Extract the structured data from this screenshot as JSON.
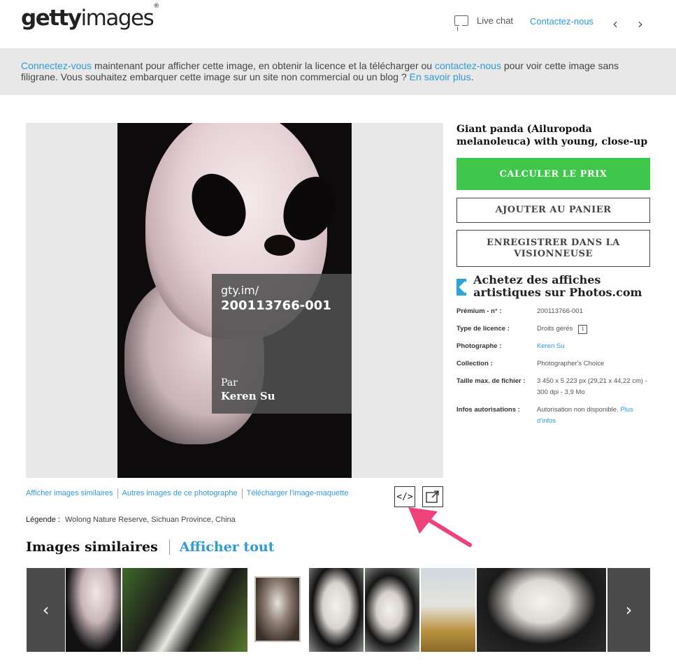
{
  "header": {
    "logo_bold": "getty",
    "logo_light": "images",
    "logo_mark": "®",
    "live_chat": "Live chat",
    "contact": "Contactez-nous",
    "prev_icon": "chevron-left-icon",
    "next_icon": "chevron-right-icon"
  },
  "banner": {
    "link1": "Connectez-vous",
    "text1": " maintenant pour afficher cette image, en obtenir la licence et la télécharger ou ",
    "link2": "contactez-nous",
    "text2": " pour voir cette image sans filigrane. Vous souhaitez embarquer cette image sur un site non commercial ou un blog ? ",
    "link3": "En savoir plus",
    "text3": "."
  },
  "watermark": {
    "url": "gty.im/",
    "id": "200113766-001",
    "by": "Par",
    "name": "Keren Su"
  },
  "image_links": [
    "Afficher images similaires",
    "Autres images de ce photographe",
    "Télécharger l'image-maquette"
  ],
  "tools": {
    "embed": "</>",
    "expand": "↗"
  },
  "legend": {
    "label": "Légende :",
    "value": "Wolong Nature Reserve, Sichuan Province, China"
  },
  "similar": {
    "title": "Images similaires",
    "all": "Afficher tout"
  },
  "strip_nav": {
    "prev": "‹",
    "next": "›"
  },
  "side": {
    "title": "Giant panda (Ailuropoda melanoleuca) with young, close-up",
    "calc_button": "CALCULER LE PRIX",
    "cart_button": "AJOUTER AU PANIER",
    "save_button": "ENREGISTRER DANS LA VISIONNEUSE",
    "promo": "Achetez des affiches artistiques sur Photos.com",
    "details": {
      "premium_label": "Prémium - n° :",
      "premium_value": "200113766-001",
      "license_label": "Type de licence :",
      "license_value": "Droits gérés",
      "license_info": "i",
      "photographer_label": "Photographe :",
      "photographer_value": "Keren Su",
      "collection_label": "Collection :",
      "collection_value": "Photographer's Choice",
      "size_label": "Taille max. de fichier :",
      "size_value": "3 450 x 5 223 px (29,21 x 44,22 cm) - 300 dpi - 3,9 Mo",
      "auth_label": "Infos autorisations :",
      "auth_value": "Autorisation non disponible. ",
      "auth_link": "Plus d'infos"
    }
  },
  "colors": {
    "accent": "#2e9ad6",
    "green": "#3fc64b",
    "pointer": "#f0427a"
  }
}
